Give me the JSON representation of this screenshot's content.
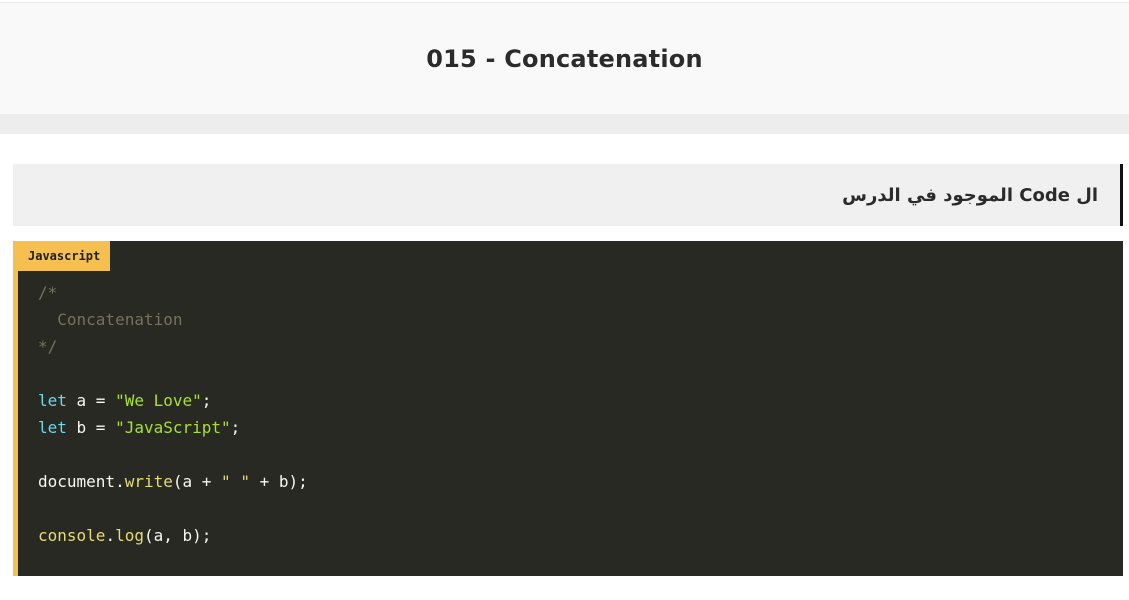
{
  "page": {
    "title": "015 - Concatenation"
  },
  "section": {
    "heading": "ال Code الموجود في الدرس"
  },
  "code_block": {
    "language_label": "Javascript",
    "lines": [
      [
        {
          "t": "comment",
          "v": "/*"
        }
      ],
      [
        {
          "t": "comment",
          "v": "  Concatenation"
        }
      ],
      [
        {
          "t": "comment",
          "v": "*/"
        }
      ],
      [],
      [
        {
          "t": "keyword",
          "v": "let"
        },
        {
          "t": "plain",
          "v": " a = "
        },
        {
          "t": "string",
          "v": "\"We Love\""
        },
        {
          "t": "plain",
          "v": ";"
        }
      ],
      [
        {
          "t": "keyword",
          "v": "let"
        },
        {
          "t": "plain",
          "v": " b = "
        },
        {
          "t": "string",
          "v": "\"JavaScript\""
        },
        {
          "t": "plain",
          "v": ";"
        }
      ],
      [],
      [
        {
          "t": "plain",
          "v": "document."
        },
        {
          "t": "function",
          "v": "write"
        },
        {
          "t": "plain",
          "v": "(a + "
        },
        {
          "t": "function",
          "v": "\" \""
        },
        {
          "t": "plain",
          "v": " + b);"
        }
      ],
      [],
      [
        {
          "t": "function",
          "v": "console"
        },
        {
          "t": "plain",
          "v": "."
        },
        {
          "t": "function",
          "v": "log"
        },
        {
          "t": "plain",
          "v": "(a, b);"
        }
      ]
    ]
  },
  "colors": {
    "code_background": "#282923",
    "accent": "#f5c04f",
    "comment": "#75715e",
    "keyword": "#66d9ef",
    "string": "#a6e22e",
    "function": "#e6db74"
  }
}
